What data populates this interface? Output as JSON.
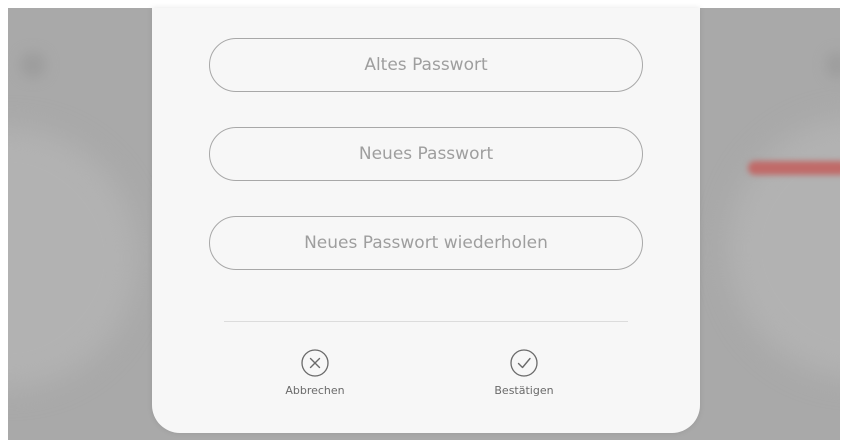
{
  "form": {
    "old_password_placeholder": "Altes Passwort",
    "new_password_placeholder": "Neues Passwort",
    "repeat_password_placeholder": "Neues Passwort wiederholen"
  },
  "actions": {
    "cancel": {
      "label": "Abbrechen",
      "icon": "close-circle-icon"
    },
    "confirm": {
      "label": "Bestätigen",
      "icon": "check-circle-icon"
    }
  },
  "colors": {
    "modal_background": "#f7f7f7",
    "field_border": "#a8a8a8",
    "placeholder_text": "#9e9e9e",
    "backdrop": "#a9a9a9",
    "background_accent": "#c06a68"
  }
}
